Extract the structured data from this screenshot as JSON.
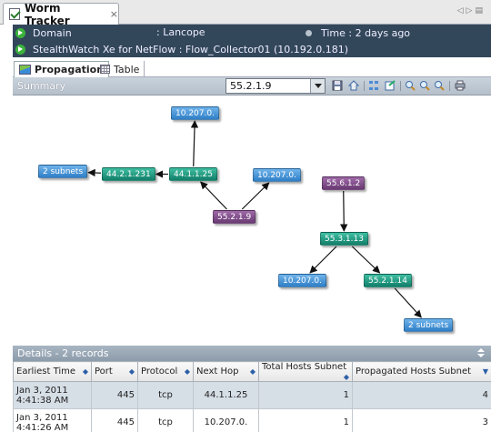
{
  "tab": {
    "title": "Worm Tracker",
    "close": "×"
  },
  "info": {
    "domain_label": "Domain",
    "domain_value": ": Lancope",
    "time": "Time : 2 days ago",
    "collector": "StealthWatch Xe for NetFlow : Flow_Collector01 (10.192.0.181)"
  },
  "subtabs": [
    {
      "label": "Propagation"
    },
    {
      "label": "Table"
    }
  ],
  "summary": {
    "label": "Summary",
    "selected_host": "55.2.1.9"
  },
  "graph": {
    "nodes": [
      {
        "id": "n1",
        "label": "10.207.0.",
        "color": "blue"
      },
      {
        "id": "n2",
        "label": "2 subnets",
        "color": "blue"
      },
      {
        "id": "n3",
        "label": "44.2.1.231",
        "color": "green"
      },
      {
        "id": "n4",
        "label": "44.1.1.25",
        "color": "green"
      },
      {
        "id": "n5",
        "label": "10.207.0.",
        "color": "blue"
      },
      {
        "id": "n6",
        "label": "55.2.1.9",
        "color": "purple"
      },
      {
        "id": "n7",
        "label": "55.6.1.2",
        "color": "purple"
      },
      {
        "id": "n8",
        "label": "55.3.1.13",
        "color": "green"
      },
      {
        "id": "n9",
        "label": "10.207.0.",
        "color": "blue"
      },
      {
        "id": "n10",
        "label": "55.2.1.14",
        "color": "green"
      },
      {
        "id": "n11",
        "label": "2 subnets",
        "color": "blue"
      }
    ],
    "edges": [
      [
        "n4",
        "n1"
      ],
      [
        "n4",
        "n3"
      ],
      [
        "n3",
        "n2"
      ],
      [
        "n6",
        "n4"
      ],
      [
        "n6",
        "n5"
      ],
      [
        "n7",
        "n8"
      ],
      [
        "n8",
        "n9"
      ],
      [
        "n8",
        "n10"
      ],
      [
        "n10",
        "n11"
      ]
    ]
  },
  "details": {
    "label": "Details - 2 records",
    "columns": [
      "Earliest Time",
      "Port",
      "Protocol",
      "Next Hop",
      "Total Hosts Subnet",
      "Propagated Hosts Subnet"
    ],
    "rows": [
      {
        "time1": "Jan 3, 2011",
        "time2": "4:41:38 AM",
        "port": "445",
        "protocol": "tcp",
        "next_hop": "44.1.1.25",
        "total": "1",
        "propagated": "4"
      },
      {
        "time1": "Jan 3, 2011",
        "time2": "4:41:26 AM",
        "port": "445",
        "protocol": "tcp",
        "next_hop": "10.207.0.",
        "total": "1",
        "propagated": "3"
      }
    ]
  },
  "colors": {
    "blue": "#3a8dd8",
    "green": "#1a9a80",
    "purple": "#7d4a86",
    "header_bg": "#33475b"
  },
  "icons": [
    "checkbox-icon",
    "play-circle-icon",
    "propagation-icon",
    "table-grid-icon",
    "dropdown-arrow-icon",
    "save-icon",
    "home-icon",
    "layout-icon",
    "export-icon",
    "zoom-in-icon",
    "zoom-out-icon",
    "zoom-fit-icon",
    "print-icon"
  ]
}
